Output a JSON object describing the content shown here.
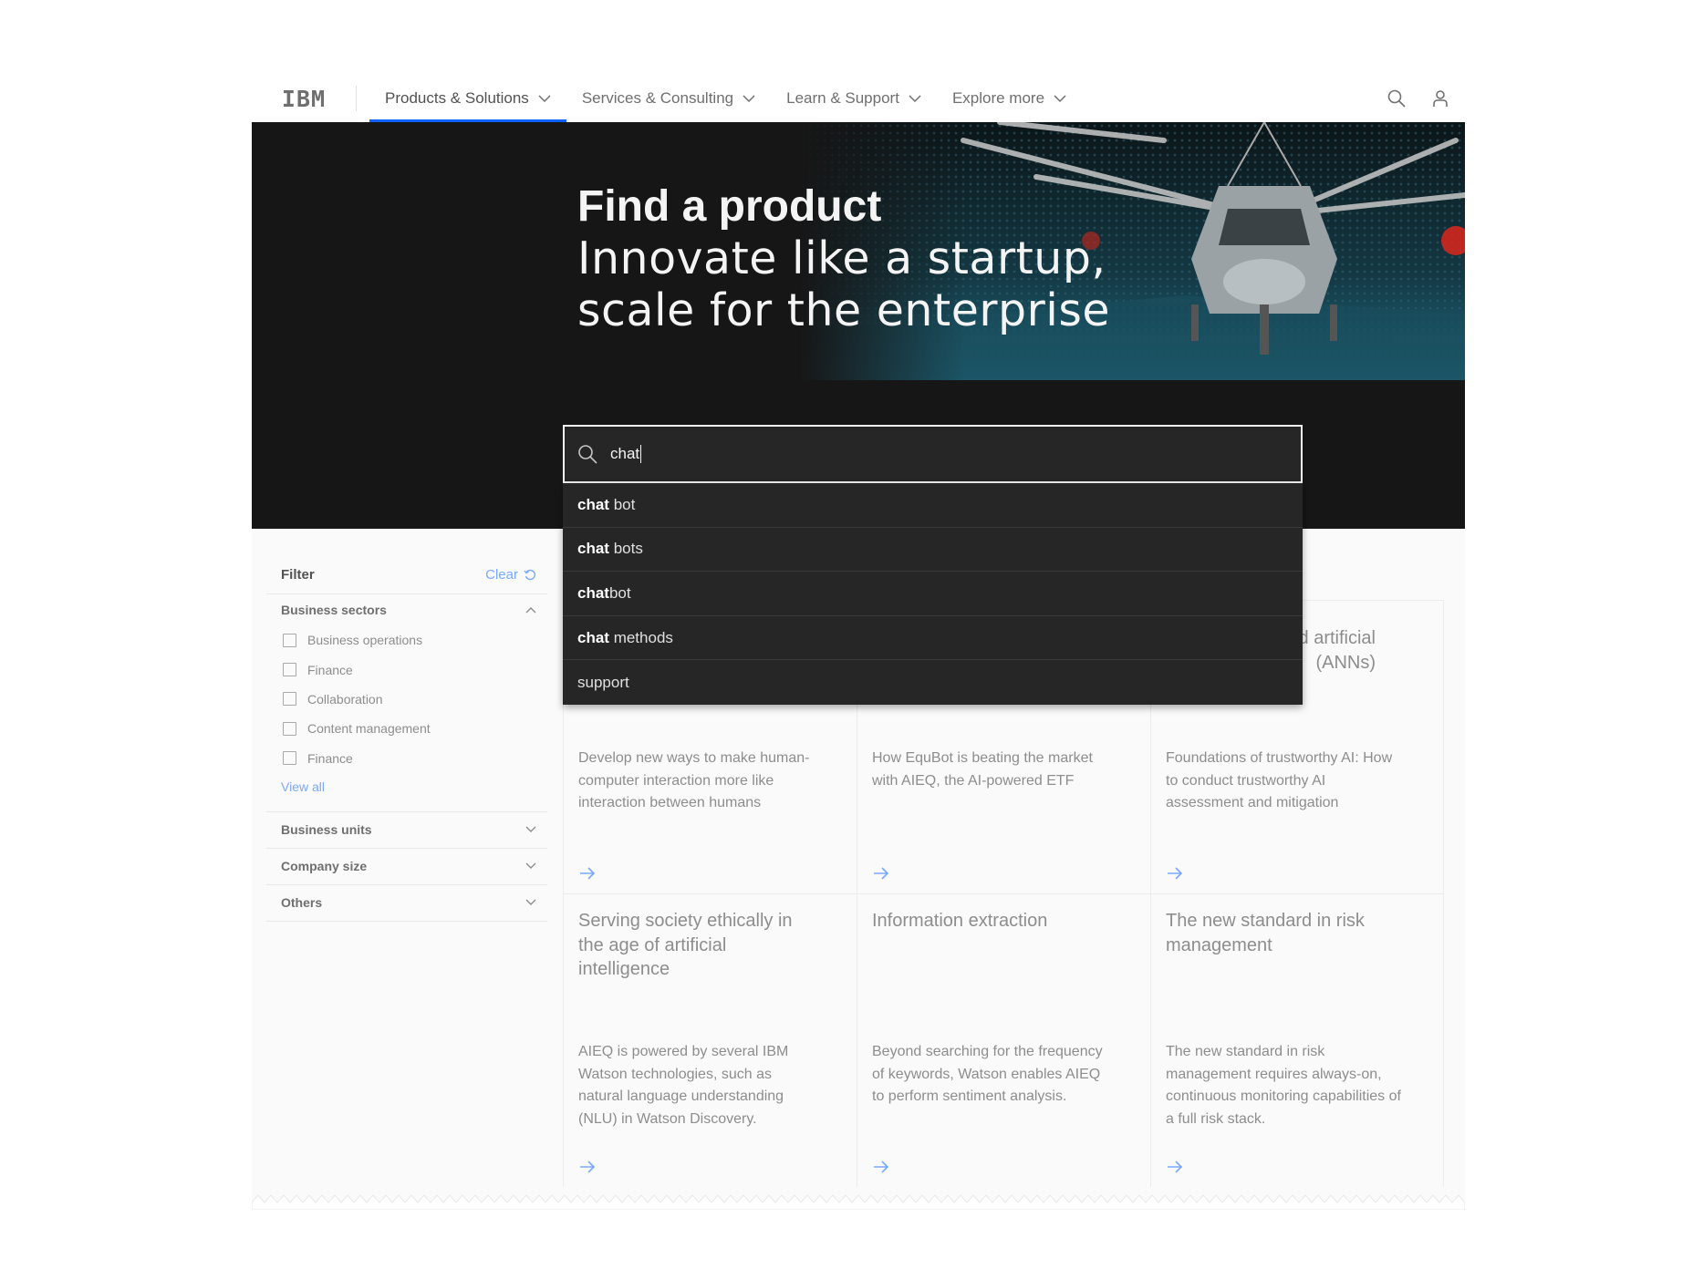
{
  "nav": {
    "logo": "IBM",
    "items": [
      {
        "label": "Products & Solutions"
      },
      {
        "label": "Services & Consulting"
      },
      {
        "label": "Learn & Support"
      },
      {
        "label": "Explore more"
      }
    ],
    "icons": [
      "search-icon",
      "user-icon"
    ],
    "accent": "#0f62fe"
  },
  "hero": {
    "title": "Find a product",
    "subtitle_line1": "Innovate like a startup,",
    "subtitle_line2": "scale for the enterprise"
  },
  "search": {
    "value": "chat"
  },
  "suggestions": [
    {
      "match": "chat",
      "rest": " bot"
    },
    {
      "match": "chat",
      "rest": " bots"
    },
    {
      "match": "chat",
      "rest": "bot"
    },
    {
      "match": "chat",
      "rest": " methods"
    },
    {
      "match": "",
      "rest": "support"
    }
  ],
  "filter": {
    "title": "Filter",
    "clear_label": "Clear",
    "groups": [
      {
        "label": "Business sectors",
        "options": [
          "Business operations",
          "Finance",
          "Collaboration",
          "Content management",
          "Finance"
        ],
        "view_all": "View all"
      },
      {
        "label": "Business units"
      },
      {
        "label": "Company size"
      },
      {
        "label": "Others"
      }
    ]
  },
  "cards": [
    {
      "title": "",
      "desc": "Develop new ways to make human-computer interaction more like interaction between humans"
    },
    {
      "title": "",
      "desc": "How EquBot is beating the market with AIEQ, the AI-powered ETF"
    },
    {
      "title": "nd artificial\n(ANNs)",
      "desc": "Foundations of trustworthy AI: How to conduct trustworthy AI assessment and mitigation"
    },
    {
      "title": "Serving society ethically in the age of artificial intelligence",
      "desc": "AIEQ is powered by several IBM Watson technologies, such as natural language understanding (NLU) in Watson Discovery."
    },
    {
      "title": "Information extraction",
      "desc": "Beyond searching for the frequency of keywords, Watson enables AIEQ to perform sentiment analysis."
    },
    {
      "title": "The new standard in risk management",
      "desc": "The new standard in risk management requires always-on, continuous monitoring capabilities of a full risk stack."
    }
  ]
}
